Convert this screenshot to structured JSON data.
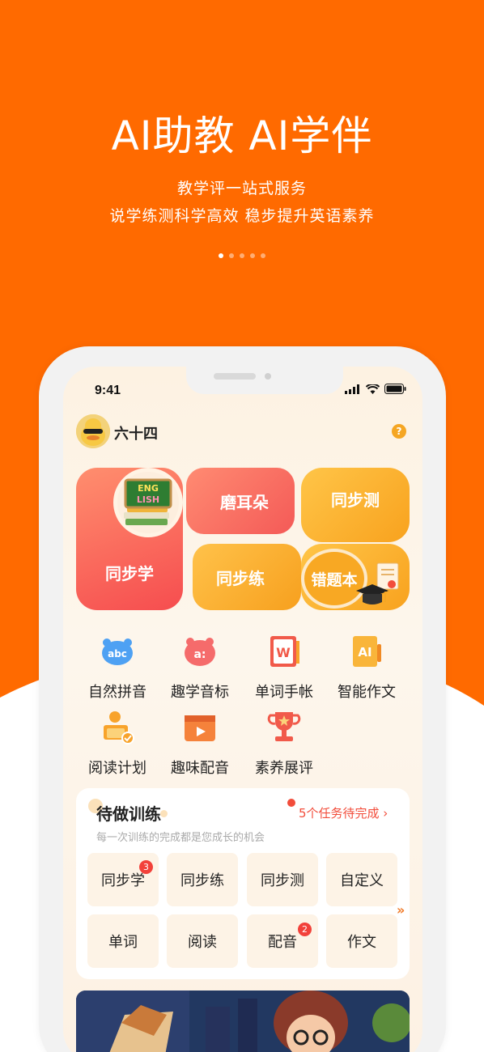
{
  "hero": {
    "title": "AI助教 AI学伴",
    "subtitle_1": "教学评一站式服务",
    "subtitle_2": "说学练测科学高效 稳步提升英语素养",
    "page_dots": 5,
    "active_dot": 1
  },
  "colors": {
    "brand_orange": "#ff6a00",
    "tile_red": "#f65a55",
    "tile_yellow": "#f9aa28",
    "accent_red": "#f24d3b"
  },
  "status_bar": {
    "time": "9:41"
  },
  "profile": {
    "username": "六十四",
    "help_icon": "question-icon"
  },
  "feature_tiles": {
    "tongbuxue": "同步学",
    "moerduo": "磨耳朵",
    "tongbuce": "同步测",
    "tongbulian": "同步练",
    "cuotiben": "错题本",
    "english_badge": "ENGLISH"
  },
  "functions": [
    {
      "label": "自然拼音",
      "icon": "abc-icon",
      "icon_text": "abc"
    },
    {
      "label": "趣学音标",
      "icon": "phonetic-icon",
      "icon_text": "a:"
    },
    {
      "label": "单词手帐",
      "icon": "word-book-icon",
      "icon_text": "W"
    },
    {
      "label": "智能作文",
      "icon": "ai-writing-icon",
      "icon_text": "AI"
    },
    {
      "label": "阅读计划",
      "icon": "reading-plan-icon"
    },
    {
      "label": "趣味配音",
      "icon": "dubbing-icon"
    },
    {
      "label": "素养展评",
      "icon": "trophy-icon"
    }
  ],
  "todo": {
    "title": "待做训练",
    "subtitle": "每一次训练的完成都是您成长的机会",
    "link": "5个任务待完成 ›",
    "tasks": [
      {
        "label": "同步学",
        "badge": "3"
      },
      {
        "label": "同步练",
        "badge": ""
      },
      {
        "label": "同步测",
        "badge": ""
      },
      {
        "label": "自定义",
        "badge": ""
      },
      {
        "label": "单词",
        "badge": ""
      },
      {
        "label": "阅读",
        "badge": ""
      },
      {
        "label": "配音",
        "badge": "2"
      },
      {
        "label": "作文",
        "badge": ""
      }
    ],
    "more": "»"
  }
}
